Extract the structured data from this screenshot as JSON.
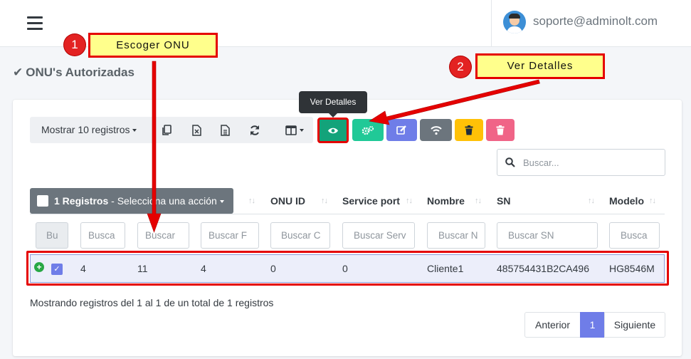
{
  "navbar": {
    "user_email": "soporte@adminolt.com"
  },
  "page": {
    "title": "ONU's Autorizadas"
  },
  "toolbar": {
    "show_records": "Mostrar 10 registros",
    "tooltip": "Ver Detalles"
  },
  "search": {
    "placeholder": "Buscar..."
  },
  "table": {
    "bulk_count": "1 Registros",
    "bulk_action": " - Selecciona una acción",
    "headers": [
      "ONU ID",
      "Service port",
      "Nombre",
      "SN",
      "Modelo"
    ],
    "filters": [
      "Bu",
      "Busca",
      "Buscar",
      "Buscar F",
      "Buscar C",
      "Buscar Serv",
      "Buscar N",
      "Buscar SN",
      "Busca"
    ],
    "row": [
      "4",
      "11",
      "4",
      "0",
      "0",
      "Cliente1",
      "485754431B2CA496",
      "HG8546M"
    ]
  },
  "footer": {
    "info": "Mostrando registros del 1 al 1 de un total de 1 registros",
    "prev": "Anterior",
    "page": "1",
    "next": "Siguiente"
  },
  "annotations": {
    "step1_number": "1",
    "step1_label": "Escoger ONU",
    "step2_number": "2",
    "step2_label": "Ver Detalles"
  },
  "colors": {
    "accent": "#6f7de8",
    "view_button": "#13a37a",
    "highlight": "#e50000"
  }
}
